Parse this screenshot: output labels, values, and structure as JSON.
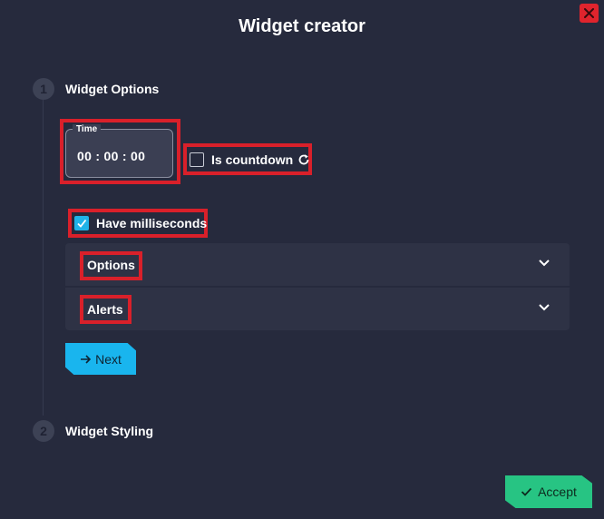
{
  "window": {
    "title": "Widget creator"
  },
  "steps": [
    {
      "number": "1",
      "label": "Widget Options"
    },
    {
      "number": "2",
      "label": "Widget Styling"
    }
  ],
  "time": {
    "legend": "Time",
    "value": "00 : 00 : 00"
  },
  "is_countdown": {
    "label": "Is countdown",
    "checked": false
  },
  "have_milliseconds": {
    "label": "Have milliseconds",
    "checked": true
  },
  "accordions": [
    {
      "label": "Options"
    },
    {
      "label": "Alerts"
    }
  ],
  "buttons": {
    "next": "Next",
    "accept": "Accept"
  },
  "colors": {
    "background": "#262a3d",
    "highlight": "#d9202a",
    "next_button": "#19b5ee",
    "accept_button": "#27c483",
    "close_button": "#e0242d",
    "checkbox_checked": "#20b3e8"
  },
  "icons": {
    "close": "close-icon",
    "countdown": "refresh-icon",
    "next": "arrow-right-icon",
    "accept": "check-icon",
    "accordion": "chevron-down-icon"
  }
}
